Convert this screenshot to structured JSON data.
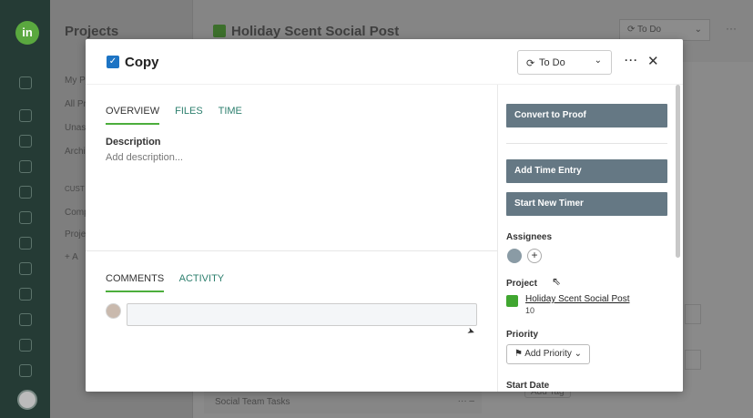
{
  "background": {
    "sidebar_title": "Projects",
    "sidebar_items": [
      "My P",
      "All Pr",
      "Unas",
      "Archi",
      "CUST",
      "Comp",
      "Proje",
      "+ A"
    ],
    "main_title": "Holiday Scent Social Post",
    "status": "To Do",
    "more": "···",
    "bottom_row_label": "Social Team Tasks",
    "bottom_row_actions": "···  –",
    "add_tag": "Add Tag"
  },
  "modal": {
    "title": "Copy",
    "status_label": "To Do",
    "more": "···",
    "close": "✕",
    "tabs_top": [
      "OVERVIEW",
      "FILES",
      "TIME"
    ],
    "description_label": "Description",
    "description_placeholder": "Add description...",
    "tabs_bottom": [
      "COMMENTS",
      "ACTIVITY"
    ],
    "buttons": {
      "convert": "Convert to Proof",
      "add_time": "Add Time Entry",
      "start_timer": "Start New Timer"
    },
    "assignees_label": "Assignees",
    "assignee_add": "+",
    "project_label": "Project",
    "project_name": "Holiday Scent Social Post",
    "project_number": "10",
    "priority_label": "Priority",
    "priority_button": "Add Priority",
    "start_date_label": "Start Date"
  },
  "colors": {
    "accent_green": "#4cae3c",
    "button_slate": "#657884",
    "overlay": "#8a8a8a"
  }
}
